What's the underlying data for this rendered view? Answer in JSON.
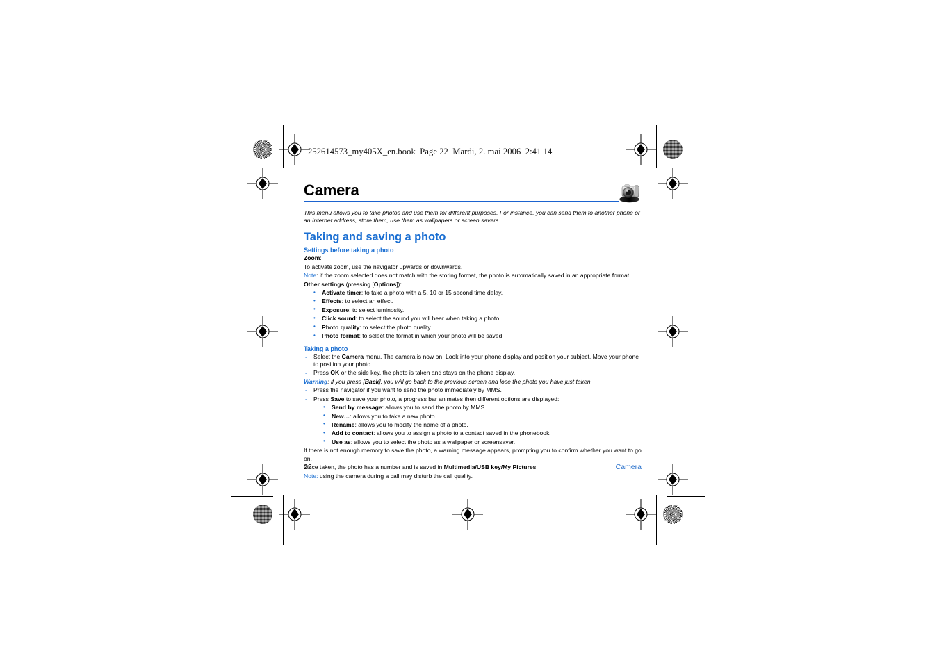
{
  "book_header": "252614573_my405X_en.book  Page 22  Mardi, 2. mai 2006  2:41 14",
  "colors": {
    "heading_blue": "#1b6fd2",
    "rule_blue": "#1b63cf",
    "footer_blue": "#2a72cc"
  },
  "chapter": {
    "title": "Camera",
    "icon": "camera-icon"
  },
  "intro": "This menu allows you to take photos and use them for different purposes. For instance, you can send them to another phone or an Internet address, store them, use them as wallpapers or screen savers.",
  "section": {
    "title": "Taking and saving a photo"
  },
  "settings": {
    "subtitle": "Settings before taking a photo",
    "zoom_label": "Zoom",
    "zoom_label_colon": ":",
    "zoom_text": "To activate zoom, use the navigator upwards or downwards.",
    "note_tag": "Note",
    "note_text": ": if the zoom selected does not match with the storing format, the photo is automatically saved in an appropriate format",
    "other_settings_label": "Other settings",
    "other_settings_rest_1": " (pressing [",
    "other_settings_options": "Options",
    "other_settings_rest_2": "]):",
    "options": [
      {
        "term": "Activate timer",
        "desc": ": to take a photo with a 5, 10 or 15 second time delay."
      },
      {
        "term": "Effects",
        "desc": ": to select an effect."
      },
      {
        "term": "Exposure",
        "desc": ": to select luminosity."
      },
      {
        "term": "Click sound",
        "desc": ": to select the sound you will hear when taking a photo."
      },
      {
        "term": "Photo quality",
        "desc": ": to select the photo quality."
      },
      {
        "term": "Photo format",
        "desc": ": to select the format in which your photo will be saved"
      }
    ]
  },
  "taking": {
    "subtitle": "Taking a photo",
    "step1_pre": "Select the ",
    "step1_bold": "Camera",
    "step1_post": " menu. The camera is now on. Look into your phone display and position your subject. Move your phone to position your photo.",
    "step2_pre": "Press ",
    "step2_bold": "OK",
    "step2_post": " or the side key, the photo is taken and stays on the phone display.",
    "warning_tag": "Warning",
    "warning_pre": ": if you press [",
    "warning_bold": "Back",
    "warning_post": "], you will go back to the previous screen and lose the photo you have just taken.",
    "step3": "Press the navigator if you want to send the photo immediately by MMS.",
    "step4_pre": "Press ",
    "step4_bold": "Save",
    "step4_post": " to save your photo, a progress bar animates then different options are displayed:",
    "save_options": [
      {
        "term": "Send by message",
        "desc": ": allows you to send the photo by MMS."
      },
      {
        "term": "New…",
        "desc": ": allows you to take a new photo."
      },
      {
        "term": "Rename",
        "desc": ": allows you to modify the name of a photo."
      },
      {
        "term": "Add to contact",
        "desc": ": allows you to assign a photo to a contact saved in the phonebook."
      },
      {
        "term": "Use as",
        "desc": ": allows you to select the photo as a wallpaper or screensaver."
      }
    ],
    "memory_text": "If there is not enough memory to save the photo, a warning message appears, prompting you to confirm whether you want to go on.",
    "saved_pre": "Once taken, the photo has a number and is saved in ",
    "saved_bold": "Multimedia/USB key/My Pictures",
    "saved_post": ".",
    "note_tag": "Note:",
    "note_text": " using the camera during a call may disturb the call quality."
  },
  "footer": {
    "page_number": "22",
    "chapter_name": "Camera"
  }
}
